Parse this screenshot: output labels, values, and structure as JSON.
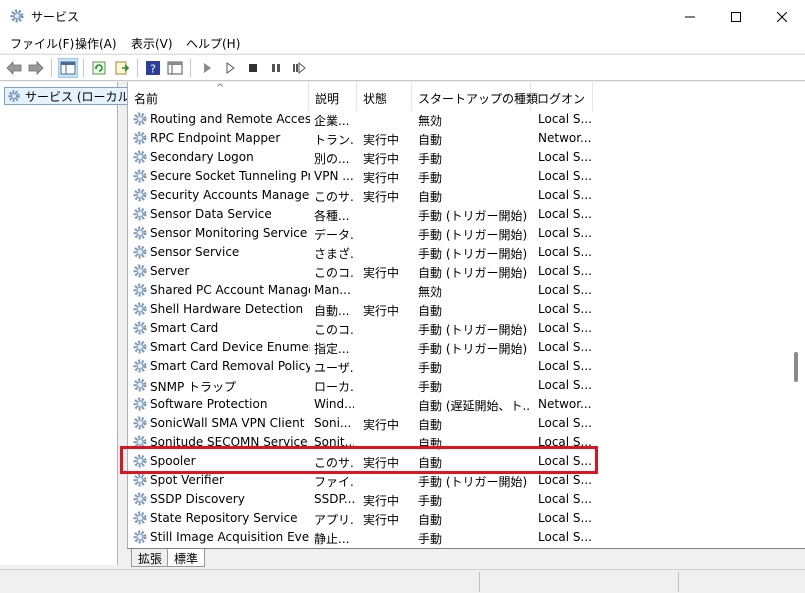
{
  "window": {
    "title": "サービス"
  },
  "menu": [
    "ファイル(F)",
    "操作(A)",
    "表示(V)",
    "ヘルプ(H)"
  ],
  "tree": {
    "root_label": "サービス (ローカル)"
  },
  "columns": {
    "name": "名前",
    "description": "説明",
    "status": "状態",
    "startup": "スタートアップの種類",
    "logon": "ログオン"
  },
  "services": [
    {
      "name": "Routing and Remote Access",
      "description": "企業...",
      "status": "",
      "startup": "無効",
      "logon": "Local S..."
    },
    {
      "name": "RPC Endpoint Mapper",
      "description": "トラン...",
      "status": "実行中",
      "startup": "自動",
      "logon": "Networ..."
    },
    {
      "name": "Secondary Logon",
      "description": "別の...",
      "status": "実行中",
      "startup": "手動",
      "logon": "Local S..."
    },
    {
      "name": "Secure Socket Tunneling Pr...",
      "description": "VPN ...",
      "status": "実行中",
      "startup": "手動",
      "logon": "Local S..."
    },
    {
      "name": "Security Accounts Manager",
      "description": "このサ...",
      "status": "実行中",
      "startup": "自動",
      "logon": "Local S..."
    },
    {
      "name": "Sensor Data Service",
      "description": "各種...",
      "status": "",
      "startup": "手動 (トリガー開始)",
      "logon": "Local S..."
    },
    {
      "name": "Sensor Monitoring Service",
      "description": "データ...",
      "status": "",
      "startup": "手動 (トリガー開始)",
      "logon": "Local S..."
    },
    {
      "name": "Sensor Service",
      "description": "さまざ...",
      "status": "",
      "startup": "手動 (トリガー開始)",
      "logon": "Local S..."
    },
    {
      "name": "Server",
      "description": "このコ...",
      "status": "実行中",
      "startup": "自動 (トリガー開始)",
      "logon": "Local S..."
    },
    {
      "name": "Shared PC Account Manager",
      "description": "Man...",
      "status": "",
      "startup": "無効",
      "logon": "Local S..."
    },
    {
      "name": "Shell Hardware Detection",
      "description": "自動...",
      "status": "実行中",
      "startup": "自動",
      "logon": "Local S..."
    },
    {
      "name": "Smart Card",
      "description": "このコ...",
      "status": "",
      "startup": "手動 (トリガー開始)",
      "logon": "Local S..."
    },
    {
      "name": "Smart Card Device Enumera...",
      "description": "指定...",
      "status": "",
      "startup": "手動 (トリガー開始)",
      "logon": "Local S..."
    },
    {
      "name": "Smart Card Removal Policy",
      "description": "ユーザ...",
      "status": "",
      "startup": "手動",
      "logon": "Local S..."
    },
    {
      "name": "SNMP トラップ",
      "description": "ローカ...",
      "status": "",
      "startup": "手動",
      "logon": "Local S..."
    },
    {
      "name": "Software Protection",
      "description": "Wind...",
      "status": "",
      "startup": "自動 (遅延開始、ト...",
      "logon": "Networ..."
    },
    {
      "name": "SonicWall SMA VPN Client",
      "description": "Soni...",
      "status": "実行中",
      "startup": "自動",
      "logon": "Local S..."
    },
    {
      "name": "Sonitude SECOMN Service",
      "description": "Sonit...",
      "status": "",
      "startup": "自動",
      "logon": "Local S..."
    },
    {
      "name": "Spooler",
      "description": "このサ...",
      "status": "実行中",
      "startup": "自動",
      "logon": "Local S..."
    },
    {
      "name": "Spot Verifier",
      "description": "ファイ...",
      "status": "",
      "startup": "手動 (トリガー開始)",
      "logon": "Local S..."
    },
    {
      "name": "SSDP Discovery",
      "description": "SSDP...",
      "status": "実行中",
      "startup": "手動",
      "logon": "Local S..."
    },
    {
      "name": "State Repository Service",
      "description": "アプリ...",
      "status": "実行中",
      "startup": "自動",
      "logon": "Local S..."
    },
    {
      "name": "Still Image Acquisition Events",
      "description": "静止...",
      "status": "",
      "startup": "手動",
      "logon": "Local S..."
    }
  ],
  "tabs": [
    "拡張",
    "標準"
  ],
  "colors": {
    "highlight": "#e0141e",
    "accent": "#1a6fc9"
  }
}
